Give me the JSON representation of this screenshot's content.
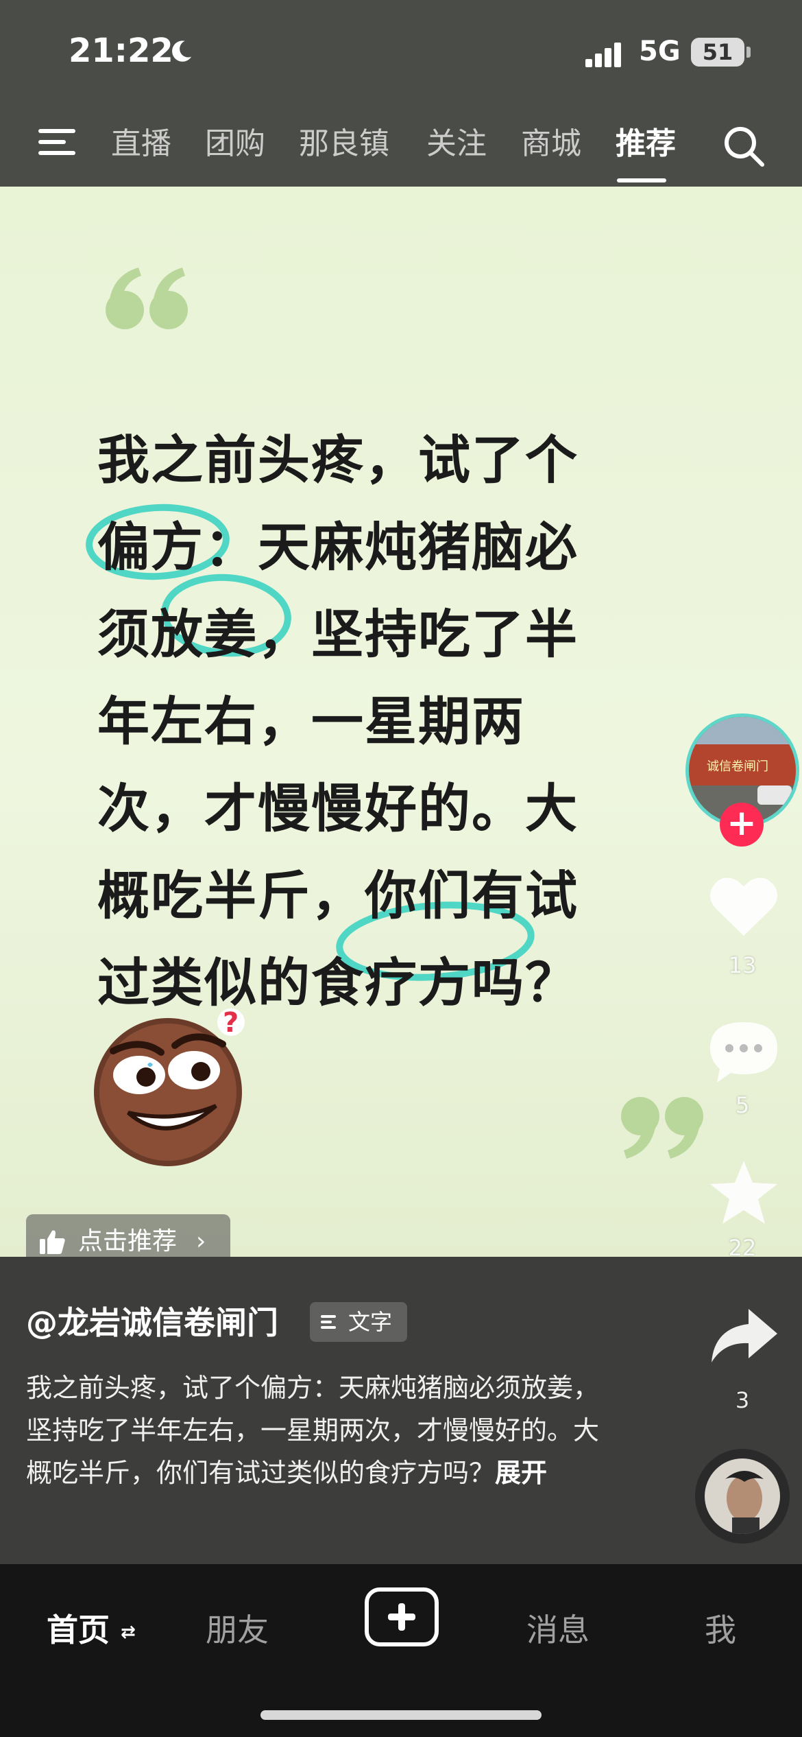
{
  "status_bar": {
    "time": "21:22",
    "network": "5G",
    "battery": "51"
  },
  "top_nav": {
    "tabs": [
      {
        "label": "直播"
      },
      {
        "label": "团购"
      },
      {
        "label": "那良镇"
      },
      {
        "label": "关注"
      },
      {
        "label": "商城"
      },
      {
        "label": "推荐"
      }
    ],
    "active_tab": "推荐"
  },
  "post": {
    "quote_lines": [
      "我之前头疼，试了个",
      "偏方：天麻炖猪脑必",
      "须放姜，坚持吃了半",
      "年左右，一星期两",
      "次，才慢慢好的。大",
      "概吃半斤，你们有试",
      "过类似的食疗方吗？"
    ],
    "recommend_label": "点击推荐",
    "recommend_chevron": "›",
    "author": "@龙岩诚信卷闸门",
    "type_badge": "文字",
    "caption": "我之前头疼，试了个偏方：天麻炖猪脑必须放姜，坚持吃了半年左右，一星期两次，才慢慢好的。大概吃半斤，你们有试过类似的食疗方吗？",
    "expand_label": "展开",
    "avatar_sign_text": "诚信卷闸门",
    "follow_plus": "+"
  },
  "actions": {
    "likes": "13",
    "comments": "5",
    "favorites": "22",
    "shares": "3"
  },
  "tab_bar": {
    "home": "首页",
    "home_switch": "⇄",
    "friends": "朋友",
    "messages": "消息",
    "me": "我"
  },
  "colors": {
    "highlight": "#4fd6c4",
    "quote_mark": "#b9d79a",
    "follow_red": "#fe2c55"
  }
}
